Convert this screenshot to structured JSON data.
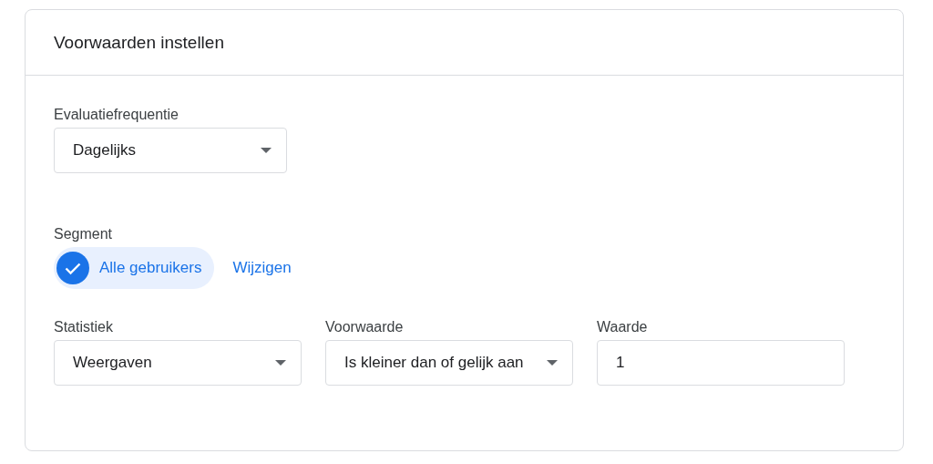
{
  "card": {
    "title": "Voorwaarden instellen"
  },
  "frequency": {
    "label": "Evaluatiefrequentie",
    "value": "Dagelijks"
  },
  "segment": {
    "label": "Segment",
    "chip": {
      "label": "Alle gebruikers",
      "selected": true
    },
    "link": "Wijzigen"
  },
  "fields": [
    {
      "kind": "dropdown",
      "label": "Statistiek",
      "value": "Weergaven"
    },
    {
      "kind": "dropdown",
      "label": "Voorwaarde",
      "value": "Is kleiner dan of gelijk aan"
    },
    {
      "kind": "input",
      "label": "Waarde",
      "value": "1"
    }
  ]
}
